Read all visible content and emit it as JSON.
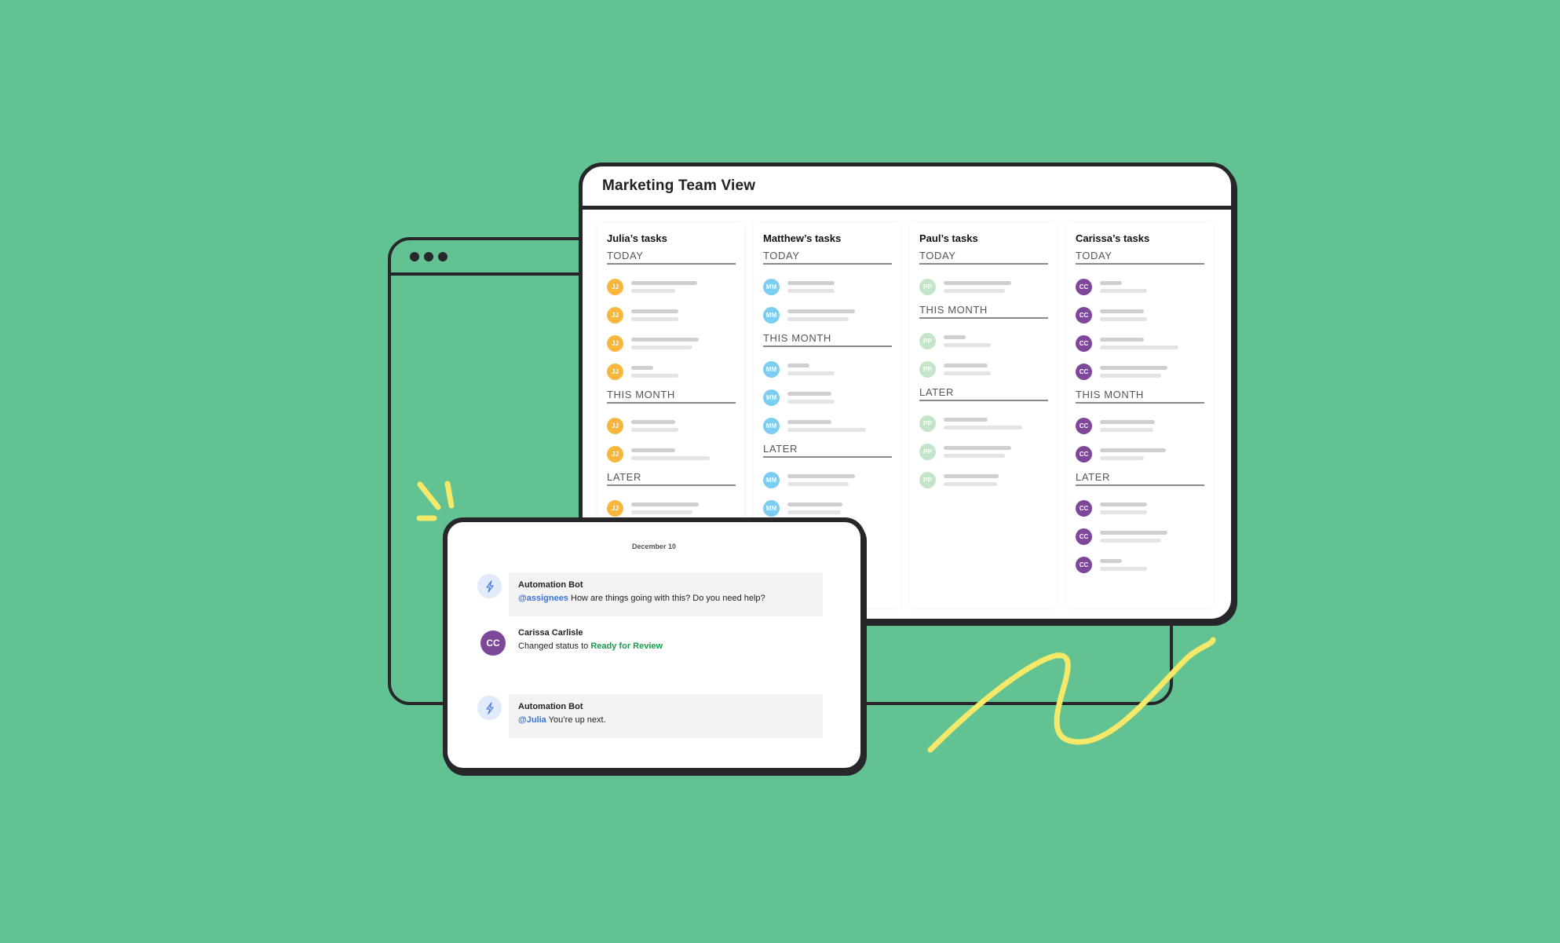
{
  "colors": {
    "background": "#63c291",
    "outline": "#26262b",
    "accent_yellow": "#f5e96a",
    "mention_blue": "#3c73d6",
    "status_green": "#1a9a4e"
  },
  "main_window": {
    "title": "Marketing Team View",
    "columns": [
      {
        "title": "Julia’s tasks",
        "initials": "JJ",
        "avatar_color": "#f7b63c",
        "sections": [
          {
            "label": "TODAY",
            "task_count": 4
          },
          {
            "label": "THIS MONTH",
            "task_count": 2
          },
          {
            "label": "LATER",
            "task_count": 1
          }
        ]
      },
      {
        "title": "Matthew’s tasks",
        "initials": "MM",
        "avatar_color": "#7ccdf2",
        "sections": [
          {
            "label": "TODAY",
            "task_count": 2
          },
          {
            "label": "THIS MONTH",
            "task_count": 3
          },
          {
            "label": "LATER",
            "task_count": 2
          }
        ]
      },
      {
        "title": "Paul’s tasks",
        "initials": "PP",
        "avatar_color": "#c3e6c9",
        "sections": [
          {
            "label": "TODAY",
            "task_count": 1
          },
          {
            "label": "THIS MONTH",
            "task_count": 2
          },
          {
            "label": "LATER",
            "task_count": 3
          }
        ]
      },
      {
        "title": "Carissa’s tasks",
        "initials": "CC",
        "avatar_color": "#7d4899",
        "sections": [
          {
            "label": "TODAY",
            "task_count": 4
          },
          {
            "label": "THIS MONTH",
            "task_count": 2
          },
          {
            "label": "LATER",
            "task_count": 3
          }
        ]
      }
    ]
  },
  "chat": {
    "date": "December 10",
    "messages": [
      {
        "author": "Automation Bot",
        "icon": "lightning-icon",
        "mention": "@assignees",
        "text": "How are things going with this? Do you need help?"
      },
      {
        "author": "Carissa Carlisle",
        "initials": "CC",
        "text_prefix": "Changed status to",
        "status": "Ready for Review"
      },
      {
        "author": "Automation Bot",
        "icon": "lightning-icon",
        "mention": "@Julia",
        "text": "You’re up next."
      }
    ]
  }
}
